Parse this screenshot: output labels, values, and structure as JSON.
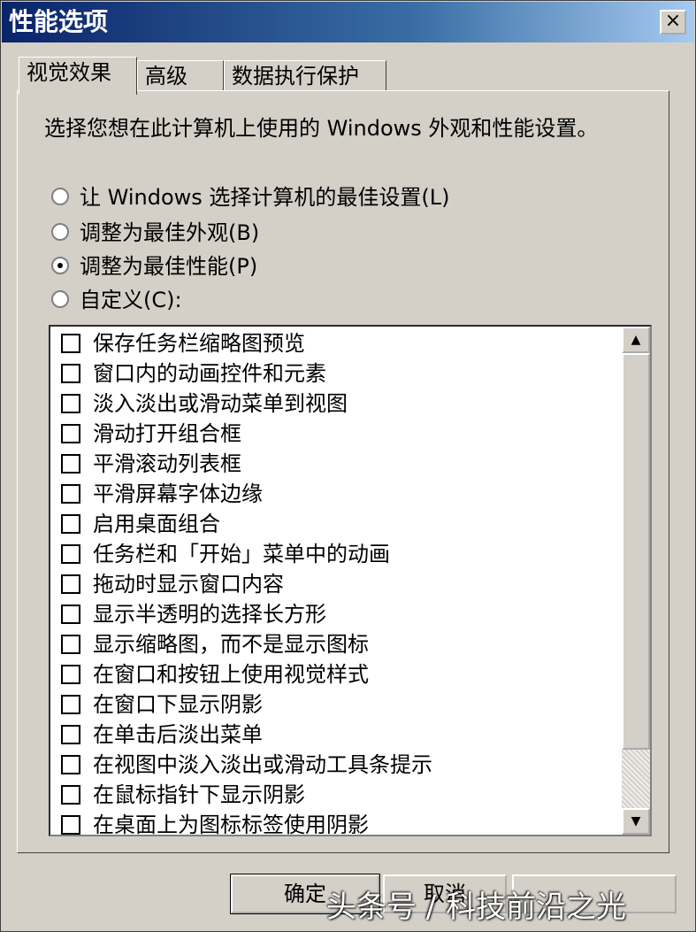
{
  "window": {
    "title": "性能选项",
    "close_glyph": "×"
  },
  "tabs": [
    {
      "label": "视觉效果",
      "active": true
    },
    {
      "label": "高级",
      "active": false
    },
    {
      "label": "数据执行保护",
      "active": false
    }
  ],
  "description": "选择您想在此计算机上使用的 Windows 外观和性能设置。",
  "radios": [
    {
      "label": "让 Windows 选择计算机的最佳设置(L)",
      "selected": false
    },
    {
      "label": "调整为最佳外观(B)",
      "selected": false
    },
    {
      "label": "调整为最佳性能(P)",
      "selected": true
    },
    {
      "label": "自定义(C):",
      "selected": false
    }
  ],
  "effects": [
    {
      "label": "保存任务栏缩略图预览",
      "checked": false
    },
    {
      "label": "窗口内的动画控件和元素",
      "checked": false
    },
    {
      "label": "淡入淡出或滑动菜单到视图",
      "checked": false
    },
    {
      "label": "滑动打开组合框",
      "checked": false
    },
    {
      "label": "平滑滚动列表框",
      "checked": false
    },
    {
      "label": "平滑屏幕字体边缘",
      "checked": false
    },
    {
      "label": "启用桌面组合",
      "checked": false
    },
    {
      "label": "任务栏和「开始」菜单中的动画",
      "checked": false
    },
    {
      "label": "拖动时显示窗口内容",
      "checked": false
    },
    {
      "label": "显示半透明的选择长方形",
      "checked": false
    },
    {
      "label": "显示缩略图，而不是显示图标",
      "checked": false
    },
    {
      "label": "在窗口和按钮上使用视觉样式",
      "checked": false
    },
    {
      "label": "在窗口下显示阴影",
      "checked": false
    },
    {
      "label": "在单击后淡出菜单",
      "checked": false
    },
    {
      "label": "在视图中淡入淡出或滑动工具条提示",
      "checked": false
    },
    {
      "label": "在鼠标指针下显示阴影",
      "checked": false
    },
    {
      "label": "在桌面上为图标标签使用阴影",
      "checked": false
    }
  ],
  "scrollbar": {
    "up_glyph": "▲",
    "down_glyph": "▼"
  },
  "buttons": {
    "ok": "确定",
    "cancel": "取消",
    "apply": ""
  },
  "watermark": "头条号 / 科技前沿之光",
  "colors": {
    "title_start": "#0a246a",
    "title_end": "#a6caf0",
    "face": "#d4d0c8"
  }
}
